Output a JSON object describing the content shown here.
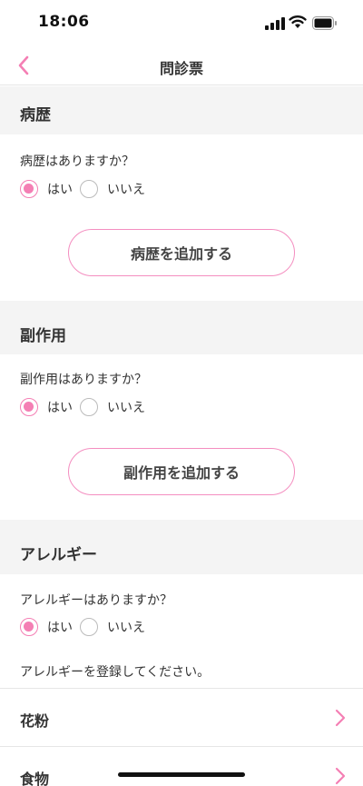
{
  "status_bar": {
    "time": "18:06"
  },
  "header": {
    "title": "問診票"
  },
  "colors": {
    "accent": "#f47fb4",
    "section_bg": "#f4f4f4"
  },
  "sections": [
    {
      "title": "病歴",
      "question": "病歴はありますか？",
      "options": [
        "はい",
        "いいえ"
      ],
      "selected": "はい",
      "button_label": "病歴を追加する"
    },
    {
      "title": "副作用",
      "question": "副作用はありますか？",
      "options": [
        "はい",
        "いいえ"
      ],
      "selected": "はい",
      "button_label": "副作用を追加する"
    },
    {
      "title": "アレルギー",
      "question": "アレルギーはありますか？",
      "options": [
        "はい",
        "いいえ"
      ],
      "selected": "はい",
      "note": "アレルギーを登録してください。",
      "items": [
        "花粉",
        "食物"
      ]
    }
  ]
}
